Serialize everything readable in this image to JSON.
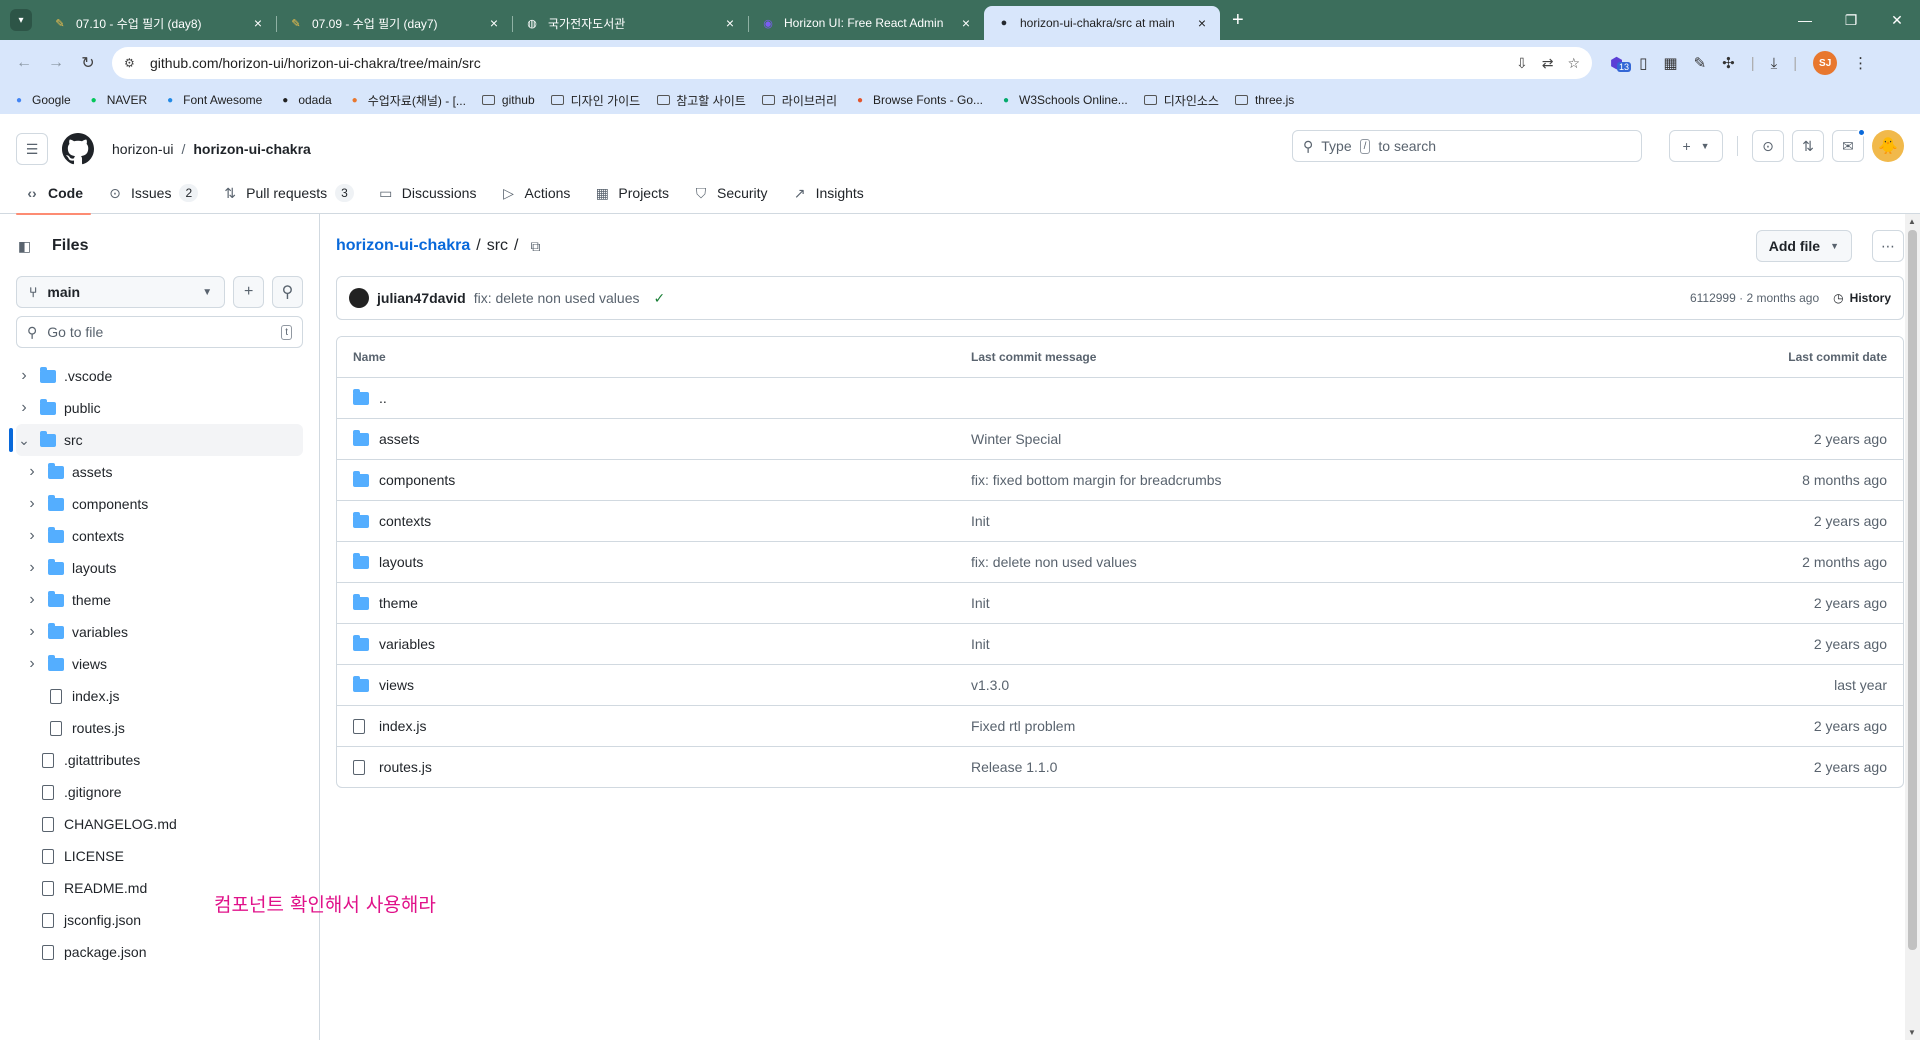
{
  "browser": {
    "tabs": [
      {
        "title": "07.10 - 수업 필기 (day8)",
        "icon": "pencil-icon",
        "active": false
      },
      {
        "title": "07.09 - 수업 필기 (day7)",
        "icon": "pencil-icon",
        "active": false
      },
      {
        "title": "국가전자도서관",
        "icon": "globe-icon",
        "active": false
      },
      {
        "title": "Horizon UI: Free React Admin",
        "icon": "horizon-icon",
        "active": false
      },
      {
        "title": "horizon-ui-chakra/src at main",
        "icon": "github-icon",
        "active": true
      }
    ],
    "url": "github.com/horizon-ui/horizon-ui-chakra/tree/main/src",
    "extension_badge": "13",
    "profile_initials": "SJ",
    "bookmarks": [
      "Google",
      "NAVER",
      "Font Awesome",
      "odada",
      "수업자료(채널) - [...",
      "github",
      "디자인 가이드",
      "참고할 사이트",
      "라이브러리",
      "Browse Fonts - Go...",
      "W3Schools Online...",
      "디자인소스",
      "three.js"
    ]
  },
  "header": {
    "owner": "horizon-ui",
    "repo": "horizon-ui-chakra",
    "search_type": "Type",
    "search_key": "/",
    "search_rest": "to search"
  },
  "repo_nav": [
    {
      "label": "Code",
      "icon": "code-icon",
      "active": true,
      "count": ""
    },
    {
      "label": "Issues",
      "icon": "issue-icon",
      "active": false,
      "count": "2"
    },
    {
      "label": "Pull requests",
      "icon": "pull-request-icon",
      "active": false,
      "count": "3"
    },
    {
      "label": "Discussions",
      "icon": "discussion-icon",
      "active": false,
      "count": ""
    },
    {
      "label": "Actions",
      "icon": "play-icon",
      "active": false,
      "count": ""
    },
    {
      "label": "Projects",
      "icon": "table-icon",
      "active": false,
      "count": ""
    },
    {
      "label": "Security",
      "icon": "shield-icon",
      "active": false,
      "count": ""
    },
    {
      "label": "Insights",
      "icon": "graph-icon",
      "active": false,
      "count": ""
    }
  ],
  "sidebar": {
    "title": "Files",
    "branch": "main",
    "goto_placeholder": "Go to file",
    "goto_key": "t",
    "tree": [
      {
        "name": ".vscode",
        "type": "folder",
        "depth": 0,
        "expanded": false
      },
      {
        "name": "public",
        "type": "folder",
        "depth": 0,
        "expanded": false
      },
      {
        "name": "src",
        "type": "folder",
        "depth": 0,
        "expanded": true,
        "selected": true
      },
      {
        "name": "assets",
        "type": "folder",
        "depth": 1,
        "expanded": false
      },
      {
        "name": "components",
        "type": "folder",
        "depth": 1,
        "expanded": false
      },
      {
        "name": "contexts",
        "type": "folder",
        "depth": 1,
        "expanded": false
      },
      {
        "name": "layouts",
        "type": "folder",
        "depth": 1,
        "expanded": false
      },
      {
        "name": "theme",
        "type": "folder",
        "depth": 1,
        "expanded": false
      },
      {
        "name": "variables",
        "type": "folder",
        "depth": 1,
        "expanded": false
      },
      {
        "name": "views",
        "type": "folder",
        "depth": 1,
        "expanded": false
      },
      {
        "name": "index.js",
        "type": "file",
        "depth": 1
      },
      {
        "name": "routes.js",
        "type": "file",
        "depth": 1
      },
      {
        "name": ".gitattributes",
        "type": "file",
        "depth": 0
      },
      {
        "name": ".gitignore",
        "type": "file",
        "depth": 0
      },
      {
        "name": "CHANGELOG.md",
        "type": "file",
        "depth": 0
      },
      {
        "name": "LICENSE",
        "type": "file",
        "depth": 0
      },
      {
        "name": "README.md",
        "type": "file",
        "depth": 0
      },
      {
        "name": "jsconfig.json",
        "type": "file",
        "depth": 0
      },
      {
        "name": "package.json",
        "type": "file",
        "depth": 0
      }
    ],
    "annotation": "컴포넌트 확인해서 사용해라"
  },
  "content": {
    "path_root": "horizon-ui-chakra",
    "path_seg": "src",
    "add_file": "Add file",
    "commit": {
      "author": "julian47david",
      "message": "fix: delete non used values",
      "hash_date": "6112999 · 2 months ago",
      "history": "History"
    },
    "columns": {
      "name": "Name",
      "message": "Last commit message",
      "date": "Last commit date"
    },
    "rows": [
      {
        "name": "..",
        "type": "folder",
        "message": "",
        "date": ""
      },
      {
        "name": "assets",
        "type": "folder",
        "message": "Winter Special",
        "date": "2 years ago"
      },
      {
        "name": "components",
        "type": "folder",
        "message": "fix: fixed bottom margin for breadcrumbs",
        "date": "8 months ago"
      },
      {
        "name": "contexts",
        "type": "folder",
        "message": "Init",
        "date": "2 years ago"
      },
      {
        "name": "layouts",
        "type": "folder",
        "message": "fix: delete non used values",
        "date": "2 months ago"
      },
      {
        "name": "theme",
        "type": "folder",
        "message": "Init",
        "date": "2 years ago"
      },
      {
        "name": "variables",
        "type": "folder",
        "message": "Init",
        "date": "2 years ago"
      },
      {
        "name": "views",
        "type": "folder",
        "message": "v1.3.0",
        "date": "last year"
      },
      {
        "name": "index.js",
        "type": "file",
        "message": "Fixed rtl problem",
        "date": "2 years ago"
      },
      {
        "name": "routes.js",
        "type": "file",
        "message": "Release 1.1.0",
        "date": "2 years ago"
      }
    ]
  },
  "colors": {
    "accent": "#0969da",
    "tab_underline": "#fd8c73",
    "folder": "#54aeff",
    "annotation": "#e0128a",
    "tabbar": "#3c6e5c"
  }
}
